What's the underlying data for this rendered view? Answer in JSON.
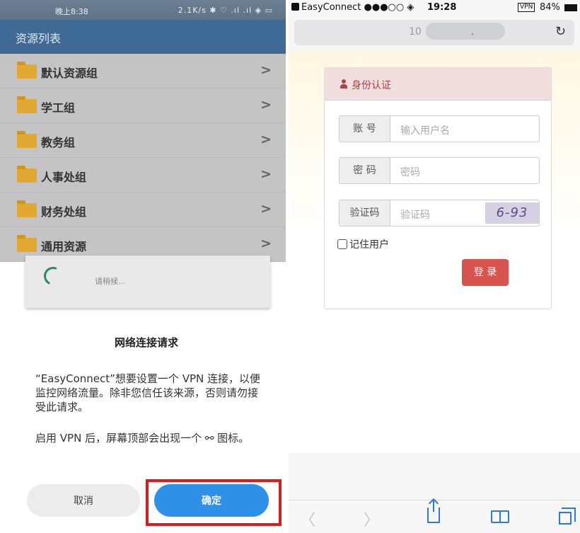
{
  "android": {
    "status": {
      "time": "晚上8:38",
      "right": "2.1K/s ✱ ♡ .ıl .ıl ◈ ▭"
    },
    "appbar": {
      "title": "资源列表"
    },
    "resources": [
      {
        "label": "默认资源组"
      },
      {
        "label": "学工组"
      },
      {
        "label": "教务组"
      },
      {
        "label": "人事处组"
      },
      {
        "label": "财务处组"
      },
      {
        "label": "通用资源"
      }
    ],
    "chevron": ">",
    "wait_text": "请稍候...",
    "dialog": {
      "title": "网络连接请求",
      "body1": "“EasyConnect”想要设置一个 VPN 连接，以便监控网络流量。除非您信任该来源，否则请勿接受此请求。",
      "body2": "启用 VPN 后，屏幕顶部会出现一个 ⚯ 图标。",
      "cancel_label": "取消",
      "ok_label": "确定"
    },
    "highlight_color": "#d21f1f"
  },
  "ios": {
    "status": {
      "app": "EasyConnect ●●●○○ ◈",
      "time": "19:28",
      "vpn": "VPN",
      "battery": "84%"
    },
    "url": {
      "text": "10",
      "dot": ".",
      "reload": "↻"
    },
    "auth": {
      "header": "身份认证",
      "username_label": "账 号",
      "username_placeholder": "输入用户名",
      "password_label": "密 码",
      "password_placeholder": "密码",
      "captcha_label": "验证码",
      "captcha_placeholder": "验证码",
      "captcha_text": "6-93",
      "remember_label": "记住用户",
      "login_label": "登 录"
    },
    "toolbar": {
      "back": "〈",
      "forward": "〉"
    },
    "accent": "#2f7ad8",
    "login_color": "#d9534f"
  }
}
